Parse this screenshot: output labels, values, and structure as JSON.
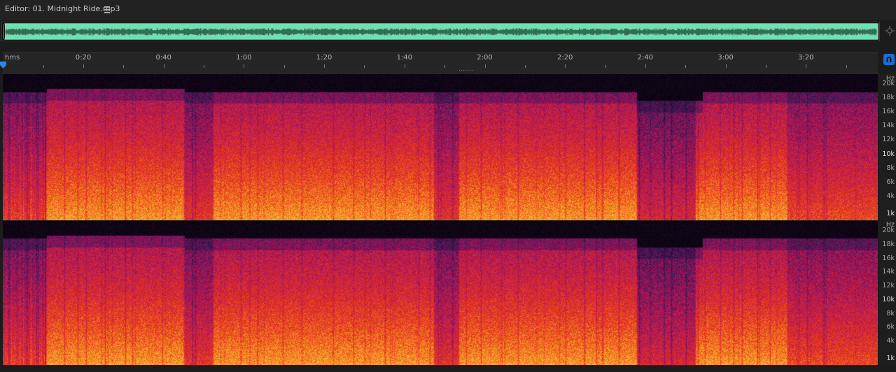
{
  "panel": {
    "title": "Editor: 01. Midnight Ride.mp3",
    "menu_icon": "hamburger-menu-icon"
  },
  "overview": {
    "waveform_color": "#6fe0b2",
    "zoom_icon": "zoom-navigator-icon"
  },
  "timeline": {
    "unit": "hms",
    "labels": [
      "0:20",
      "0:40",
      "1:00",
      "1:20",
      "1:40",
      "2:00",
      "2:20",
      "2:40",
      "3:00",
      "3:20"
    ],
    "snap_icon": "magnet-snap-icon",
    "accent": "#1a6fd2"
  },
  "spectral": {
    "unit": "Hz",
    "labels": [
      "20k",
      "18k",
      "16k",
      "14k",
      "12k",
      "10k",
      "8k",
      "6k",
      "4k",
      "1k"
    ],
    "palette": [
      "#000000",
      "#3b1654",
      "#b0155a",
      "#e8361e",
      "#f6a226",
      "#ffe27a"
    ]
  }
}
